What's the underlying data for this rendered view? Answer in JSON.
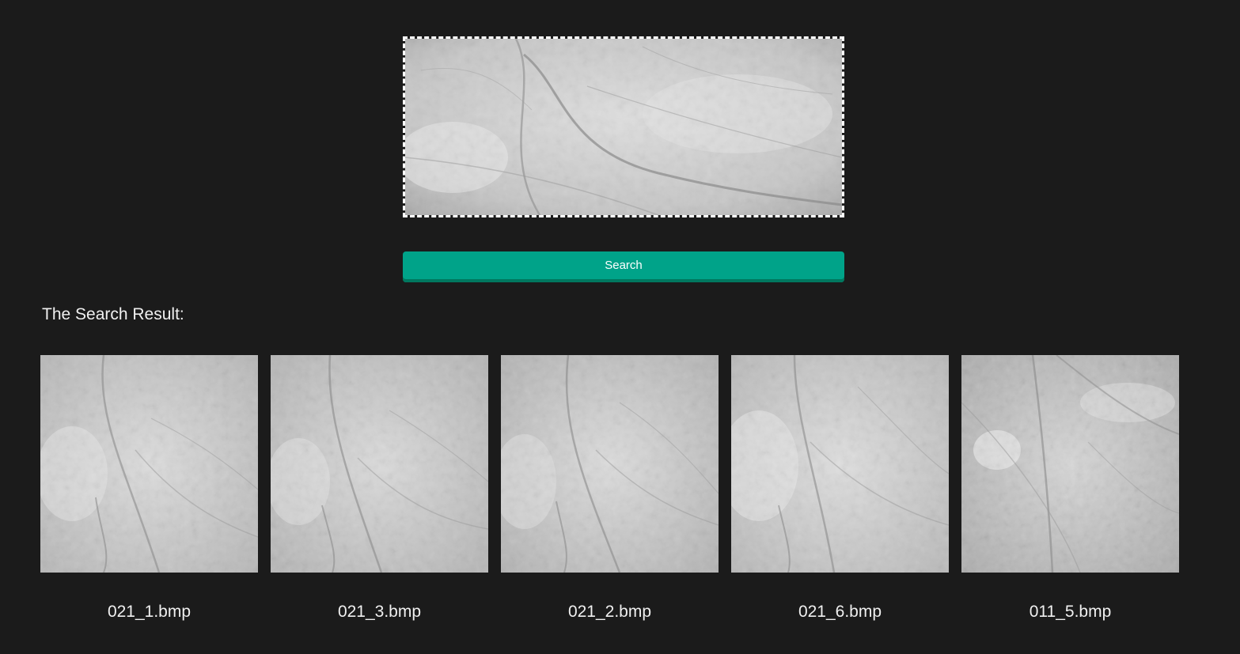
{
  "upload": {
    "image_description_icon": "palm-image"
  },
  "search": {
    "label": "Search",
    "color": "#00a389"
  },
  "results": {
    "heading": "The Search Result:",
    "items": [
      {
        "filename": "021_1.bmp"
      },
      {
        "filename": "021_3.bmp"
      },
      {
        "filename": "021_2.bmp"
      },
      {
        "filename": "021_6.bmp"
      },
      {
        "filename": "011_5.bmp"
      }
    ]
  },
  "colors": {
    "background": "#1b1b1b",
    "accent": "#00a389",
    "text": "#f0f0f0"
  }
}
